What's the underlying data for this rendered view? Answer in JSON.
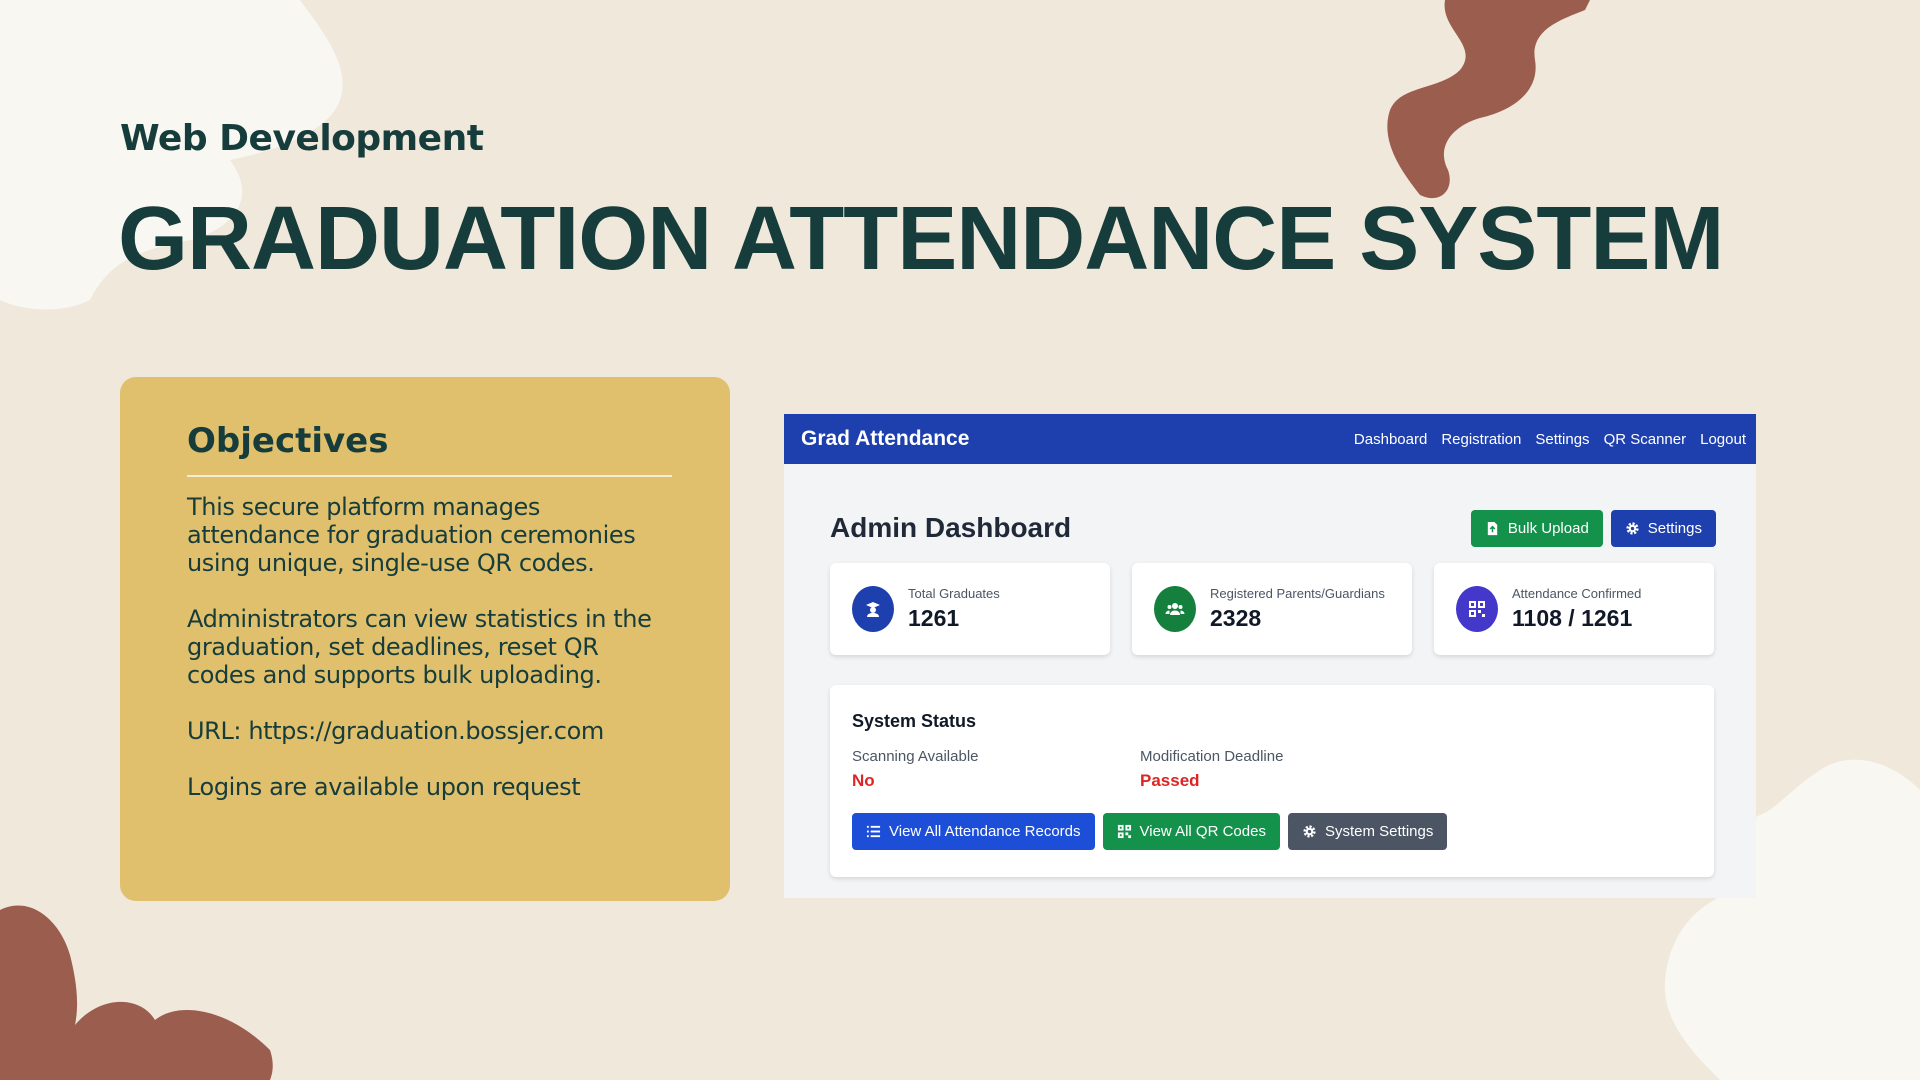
{
  "slide": {
    "subtitle": "Web Development",
    "title": "GRADUATION ATTENDANCE SYSTEM"
  },
  "objectives": {
    "heading": "Objectives",
    "paragraphs": [
      "This secure platform manages attendance for graduation ceremonies using unique, single-use QR codes.",
      "Administrators can view statistics in the graduation, set deadlines, reset QR codes and supports bulk uploading.",
      "URL: https://graduation.bossjer.com",
      "Logins are available upon request"
    ]
  },
  "app": {
    "brand": "Grad Attendance",
    "nav": [
      "Dashboard",
      "Registration",
      "Settings",
      "QR Scanner",
      "Logout"
    ],
    "page_title": "Admin Dashboard",
    "header_buttons": [
      {
        "label": "Bulk Upload",
        "icon": "file-upload-icon",
        "color": "#14924b"
      },
      {
        "label": "Settings",
        "icon": "gear-icon",
        "color": "#1e40af"
      }
    ],
    "stats": [
      {
        "label": "Total Graduates",
        "value": "1261",
        "icon": "graduate-icon",
        "color": "#1e3fae"
      },
      {
        "label": "Registered Parents/Guardians",
        "value": "2328",
        "icon": "users-icon",
        "color": "#15803d"
      },
      {
        "label": "Attendance Confirmed",
        "value": "1108 / 1261",
        "icon": "qrcode-icon",
        "color": "#4338ca"
      }
    ],
    "system_status": {
      "title": "System Status",
      "items": [
        {
          "label": "Scanning Available",
          "value": "No"
        },
        {
          "label": "Modification Deadline",
          "value": "Passed"
        }
      ],
      "buttons": [
        {
          "label": "View All Attendance Records",
          "icon": "list-icon",
          "color": "#1d4ed8"
        },
        {
          "label": "View All QR Codes",
          "icon": "qrcode-icon",
          "color": "#14924b"
        },
        {
          "label": "System Settings",
          "icon": "gear-icon",
          "color": "#4b5563"
        }
      ]
    }
  },
  "colors": {
    "background": "#efe8db",
    "primary_text": "#163c3b",
    "objectives_card": "#e0c06c",
    "brown_accent": "#9b5d4e",
    "cream_blob": "#f9f7f2",
    "navbar": "#1e3fae",
    "danger": "#dc2626"
  }
}
